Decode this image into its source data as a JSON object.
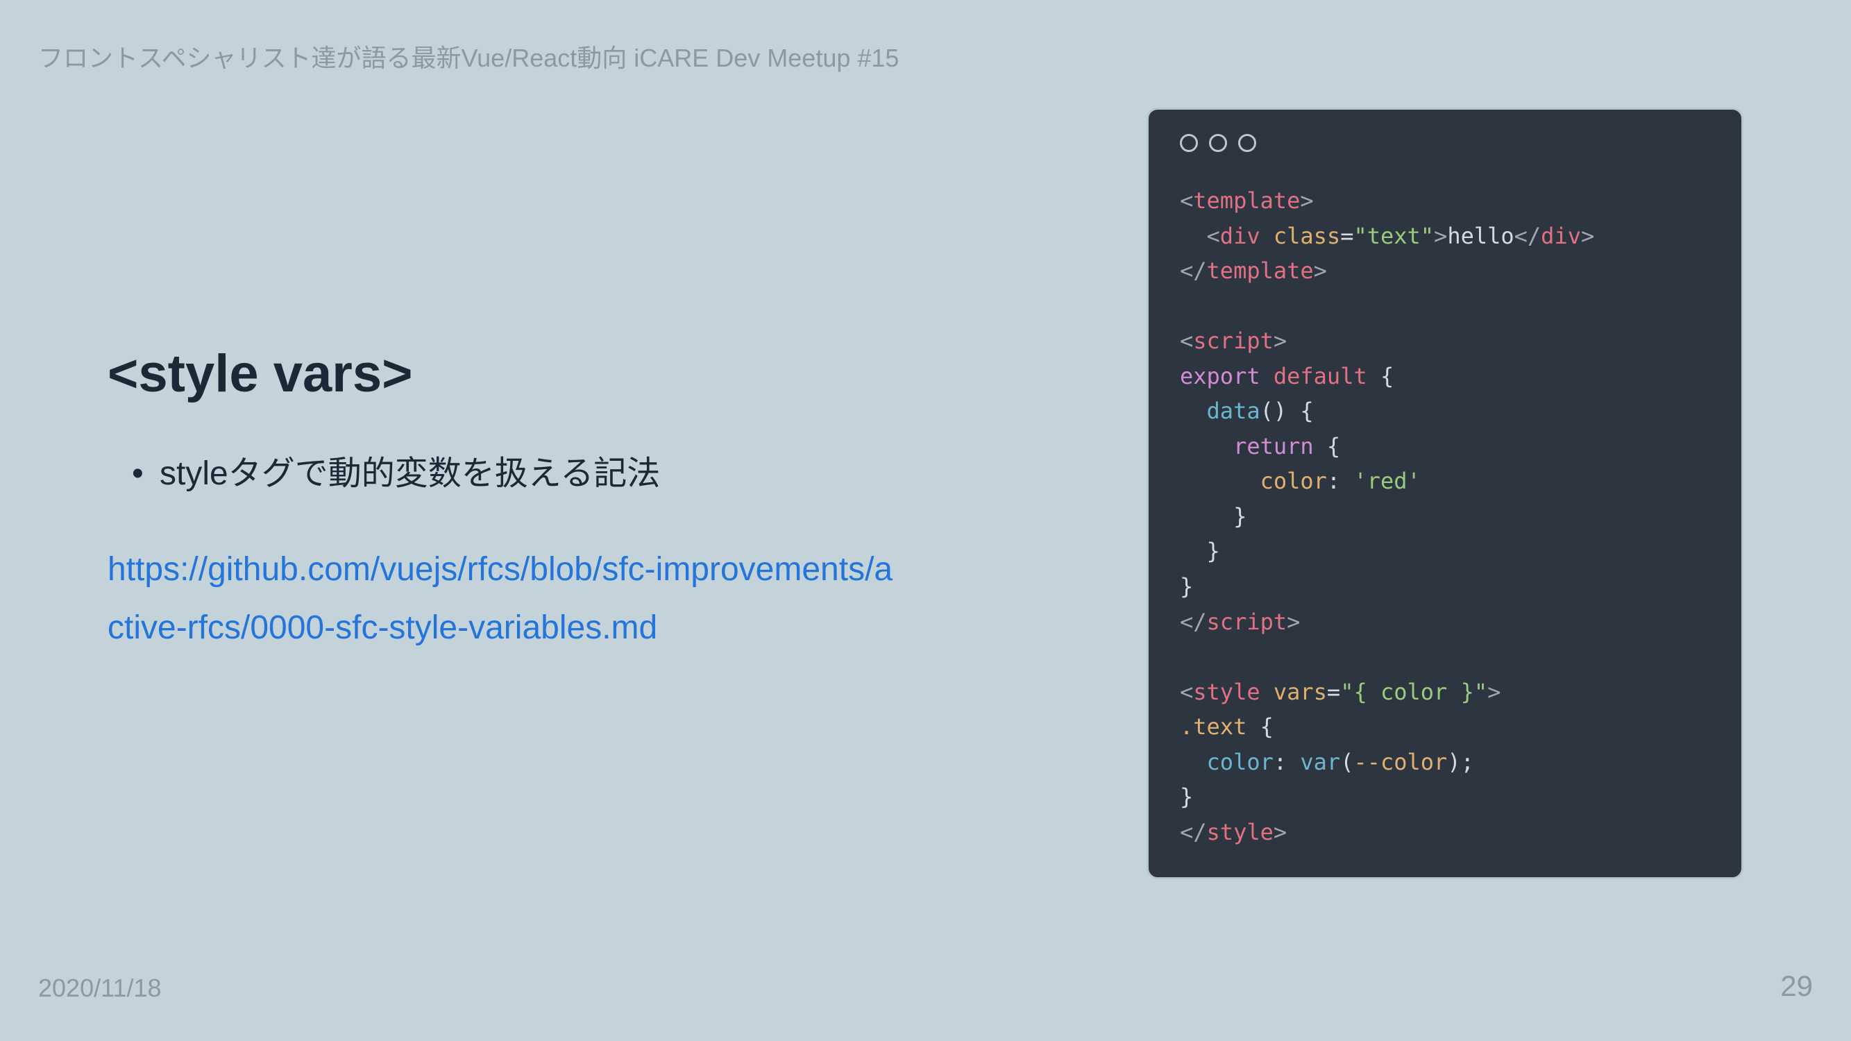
{
  "header": {
    "breadcrumb": "フロントスペシャリスト達が語る最新Vue/React動向 iCARE Dev Meetup #15"
  },
  "content": {
    "title": "<style vars>",
    "bullets": [
      "styleタグで動的変数を扱える記法"
    ],
    "link_text": "https://github.com/vuejs/rfcs/blob/sfc-improvements/active-rfcs/0000-sfc-style-variables.md"
  },
  "code": {
    "tokens": {
      "template_open": "template",
      "div": "div",
      "class_attr": "class",
      "class_val": "\"text\"",
      "hello": "hello",
      "script": "script",
      "export": "export",
      "default": "default",
      "data": "data",
      "return": "return",
      "color_prop": "color",
      "red": "'red'",
      "style": "style",
      "vars_attr": "vars",
      "vars_val": "\"{ color }\"",
      "text_sel": ".text",
      "color_css": "color",
      "var_fn": "var",
      "var_arg": "--color"
    }
  },
  "footer": {
    "date": "2020/11/18",
    "page": "29"
  }
}
